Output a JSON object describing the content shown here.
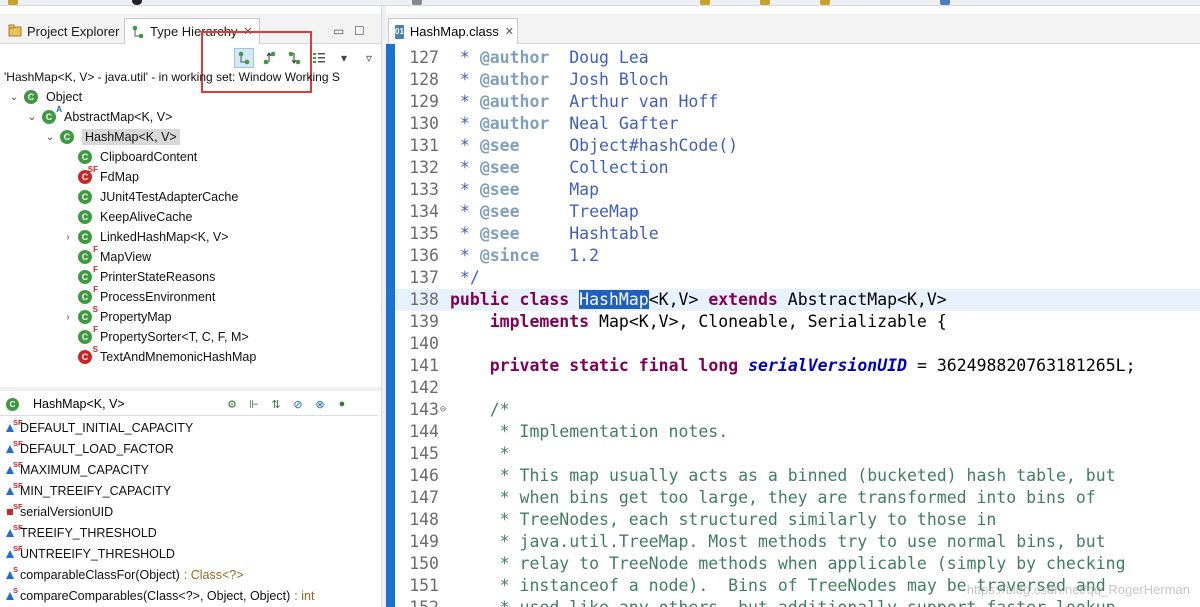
{
  "left_view": {
    "tabs": [
      {
        "label": "Project Explorer",
        "icon": "project-explorer-icon"
      },
      {
        "label": "Type Hierarchy",
        "icon": "type-hierarchy-icon",
        "active": true
      }
    ],
    "breadcrumb": "'HashMap<K, V> - java.util' - in working set: Window Working S",
    "tree": [
      {
        "label": "Object",
        "depth": 0,
        "expanded": true,
        "icon": "class-icon"
      },
      {
        "label": "AbstractMap<K, V>",
        "depth": 1,
        "expanded": true,
        "icon": "abstract-class-icon",
        "badge": "A"
      },
      {
        "label": "HashMap<K, V>",
        "depth": 2,
        "expanded": true,
        "icon": "class-icon",
        "selected": true
      },
      {
        "label": "ClipboardContent",
        "depth": 3,
        "icon": "class-icon"
      },
      {
        "label": "FdMap",
        "depth": 3,
        "icon": "static-final-class-icon",
        "badge": "SF",
        "red": true
      },
      {
        "label": "JUnit4TestAdapterCache",
        "depth": 3,
        "icon": "class-icon"
      },
      {
        "label": "KeepAliveCache",
        "depth": 3,
        "icon": "class-icon"
      },
      {
        "label": "LinkedHashMap<K, V>",
        "depth": 3,
        "icon": "class-icon",
        "collapsed": true
      },
      {
        "label": "MapView",
        "depth": 3,
        "icon": "final-class-icon",
        "badge": "F"
      },
      {
        "label": "PrinterStateReasons",
        "depth": 3,
        "icon": "final-class-icon",
        "badge": "F"
      },
      {
        "label": "ProcessEnvironment",
        "depth": 3,
        "icon": "final-class-icon",
        "badge": "F"
      },
      {
        "label": "PropertyMap",
        "depth": 3,
        "icon": "static-class-icon",
        "badge": "S",
        "collapsed": true
      },
      {
        "label": "PropertySorter<T, C, F, M>",
        "depth": 3,
        "icon": "final-class-icon",
        "badge": "F"
      },
      {
        "label": "TextAndMnemonicHashMap",
        "depth": 3,
        "icon": "static-class-icon",
        "badge": "S",
        "red": true
      }
    ],
    "members_title": "HashMap<K, V>",
    "members": [
      {
        "name": "DEFAULT_INITIAL_CAPACITY",
        "kind": "field",
        "mod": "SF"
      },
      {
        "name": "DEFAULT_LOAD_FACTOR",
        "kind": "field",
        "mod": "SF"
      },
      {
        "name": "MAXIMUM_CAPACITY",
        "kind": "field",
        "mod": "SF"
      },
      {
        "name": "MIN_TREEIFY_CAPACITY",
        "kind": "field",
        "mod": "SF"
      },
      {
        "name": "serialVersionUID",
        "kind": "private-field",
        "mod": "SF"
      },
      {
        "name": "TREEIFY_THRESHOLD",
        "kind": "field",
        "mod": "SF"
      },
      {
        "name": "UNTREEIFY_THRESHOLD",
        "kind": "field",
        "mod": "SF"
      },
      {
        "name": "comparableClassFor(Object)",
        "ret": ": Class<?>",
        "kind": "method",
        "mod": "S"
      },
      {
        "name": "compareComparables(Class<?>, Object, Object)",
        "ret": ": int",
        "kind": "method",
        "mod": "S"
      }
    ]
  },
  "editor": {
    "tab_label": "HashMap.class",
    "lines": [
      {
        "n": "127",
        "t": " * @author  Doug Lea"
      },
      {
        "n": "128",
        "t": " * @author  Josh Bloch"
      },
      {
        "n": "129",
        "t": " * @author  Arthur van Hoff"
      },
      {
        "n": "130",
        "t": " * @author  Neal Gafter"
      },
      {
        "n": "131",
        "t": " * @see     Object#hashCode()"
      },
      {
        "n": "132",
        "t": " * @see     Collection"
      },
      {
        "n": "133",
        "t": " * @see     Map"
      },
      {
        "n": "134",
        "t": " * @see     TreeMap"
      },
      {
        "n": "135",
        "t": " * @see     Hashtable"
      },
      {
        "n": "136",
        "t": " * @since   1.2"
      },
      {
        "n": "137",
        "t": " */"
      },
      {
        "n": "138",
        "t": "public class HashMap<K,V> extends AbstractMap<K,V>"
      },
      {
        "n": "139",
        "t": "    implements Map<K,V>, Cloneable, Serializable {"
      },
      {
        "n": "140",
        "t": ""
      },
      {
        "n": "141",
        "t": "    private static final long serialVersionUID = 362498820763181265L;"
      },
      {
        "n": "142",
        "t": ""
      },
      {
        "n": "143",
        "t": "    /*"
      },
      {
        "n": "144",
        "t": "     * Implementation notes."
      },
      {
        "n": "145",
        "t": "     *"
      },
      {
        "n": "146",
        "t": "     * This map usually acts as a binned (bucketed) hash table, but"
      },
      {
        "n": "147",
        "t": "     * when bins get too large, they are transformed into bins of"
      },
      {
        "n": "148",
        "t": "     * TreeNodes, each structured similarly to those in"
      },
      {
        "n": "149",
        "t": "     * java.util.TreeMap. Most methods try to use normal bins, but"
      },
      {
        "n": "150",
        "t": "     * relay to TreeNode methods when applicable (simply by checking"
      },
      {
        "n": "151",
        "t": "     * instanceof a node).  Bins of TreeNodes may be traversed and"
      },
      {
        "n": "152",
        "t": "     * used like any others, but additionally support faster lookup"
      }
    ]
  },
  "watermark": "https://blog.csdn.net/qq_RogerHerman",
  "colors": {
    "keyword": "#7f0055",
    "javadoc": "#3f5fbf",
    "javadoc_tag": "#7f9fbf",
    "comment": "#3f7f5f",
    "field": "#0000c0",
    "selection": "#1f5fbf",
    "annotation_box": "#e53935"
  }
}
